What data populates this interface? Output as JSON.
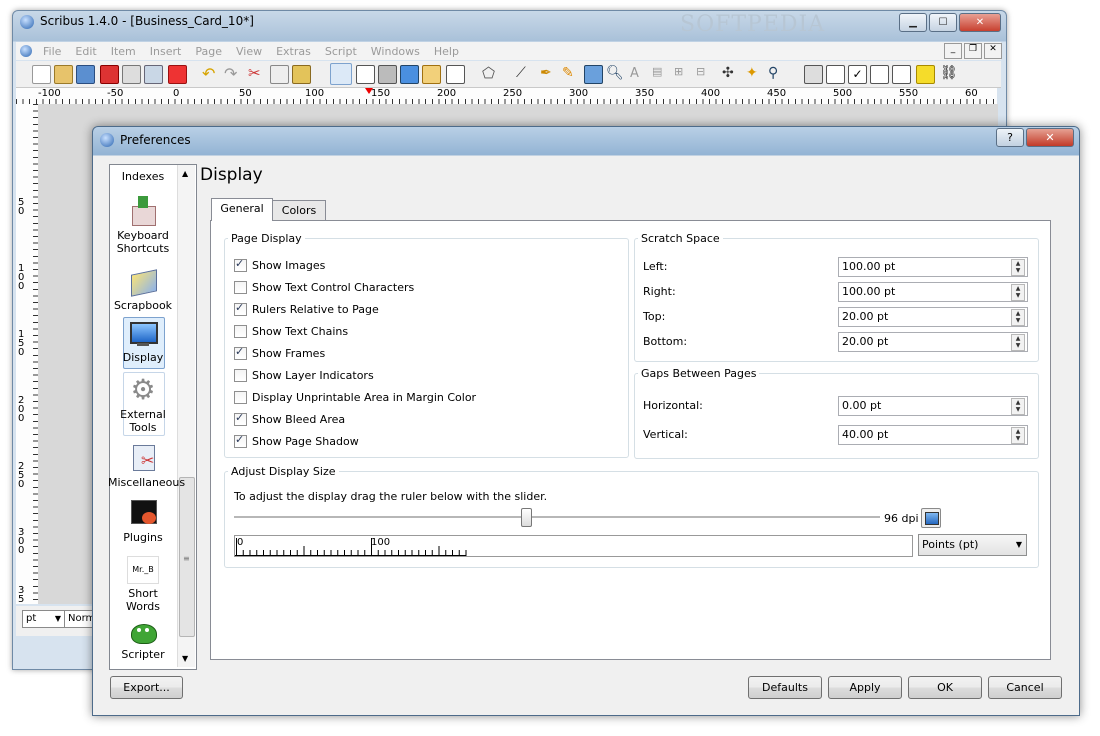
{
  "main_window": {
    "title": "Scribus 1.4.0 - [Business_Card_10*]",
    "watermark": "SOFTPEDIA",
    "menu": [
      "File",
      "Edit",
      "Item",
      "Insert",
      "Page",
      "View",
      "Extras",
      "Script",
      "Windows",
      "Help"
    ],
    "ruler_labels": [
      "-100",
      "-50",
      "0",
      "50",
      "100",
      "150",
      "200",
      "250",
      "300",
      "350",
      "400",
      "450",
      "500",
      "550",
      "60"
    ],
    "ruler_left_labels": [
      "5\n0",
      "1\n0\n0",
      "1\n5\n0",
      "2\n0\n0",
      "2\n5\n0",
      "3\n0\n0",
      "3\n5"
    ],
    "status_unit": "pt",
    "status_mode": "Norm"
  },
  "prefs": {
    "title": "Preferences",
    "help_btn": "?",
    "close_btn": "✕",
    "sidebar": [
      {
        "label": "Indexes",
        "icon": "indexes-icon"
      },
      {
        "label": "Keyboard Shortcuts",
        "icon": "keyboard-shortcuts-icon"
      },
      {
        "label": "Scrapbook",
        "icon": "scrapbook-icon"
      },
      {
        "label": "Display",
        "icon": "display-icon",
        "selected": true
      },
      {
        "label": "External Tools",
        "icon": "external-tools-icon"
      },
      {
        "label": "Miscellaneous",
        "icon": "miscellaneous-icon"
      },
      {
        "label": "Plugins",
        "icon": "plugins-icon"
      },
      {
        "label": "Short Words",
        "icon": "short-words-icon"
      },
      {
        "label": "Scripter",
        "icon": "scripter-icon"
      }
    ],
    "short_words_icon_text": "Mr._B",
    "heading": "Display",
    "tabs": [
      "General",
      "Colors"
    ],
    "page_display": {
      "title": "Page Display",
      "options": [
        {
          "label": "Show Images",
          "checked": true
        },
        {
          "label": "Show Text Control Characters",
          "checked": false
        },
        {
          "label": "Rulers Relative to Page",
          "checked": true
        },
        {
          "label": "Show Text Chains",
          "checked": false
        },
        {
          "label": "Show Frames",
          "checked": true
        },
        {
          "label": "Show Layer Indicators",
          "checked": false
        },
        {
          "label": "Display Unprintable Area in Margin Color",
          "checked": false
        },
        {
          "label": "Show Bleed Area",
          "checked": true
        },
        {
          "label": "Show Page Shadow",
          "checked": true
        }
      ]
    },
    "scratch_space": {
      "title": "Scratch Space",
      "fields": [
        {
          "label": "Left:",
          "value": "100.00 pt"
        },
        {
          "label": "Right:",
          "value": "100.00 pt"
        },
        {
          "label": "Top:",
          "value": "20.00 pt"
        },
        {
          "label": "Bottom:",
          "value": "20.00 pt"
        }
      ]
    },
    "gaps": {
      "title": "Gaps Between Pages",
      "fields": [
        {
          "label": "Horizontal:",
          "value": "0.00 pt"
        },
        {
          "label": "Vertical:",
          "value": "40.00 pt"
        }
      ]
    },
    "adjust": {
      "title": "Adjust Display Size",
      "hint": "To adjust the display drag the ruler below with the slider.",
      "dpi": "96 dpi",
      "slider_fraction": 0.45,
      "ruler_labels": [
        "0",
        "100"
      ],
      "unit": "Points (pt)"
    },
    "buttons": {
      "export": "Export...",
      "defaults": "Defaults",
      "apply": "Apply",
      "ok": "OK",
      "cancel": "Cancel"
    }
  }
}
